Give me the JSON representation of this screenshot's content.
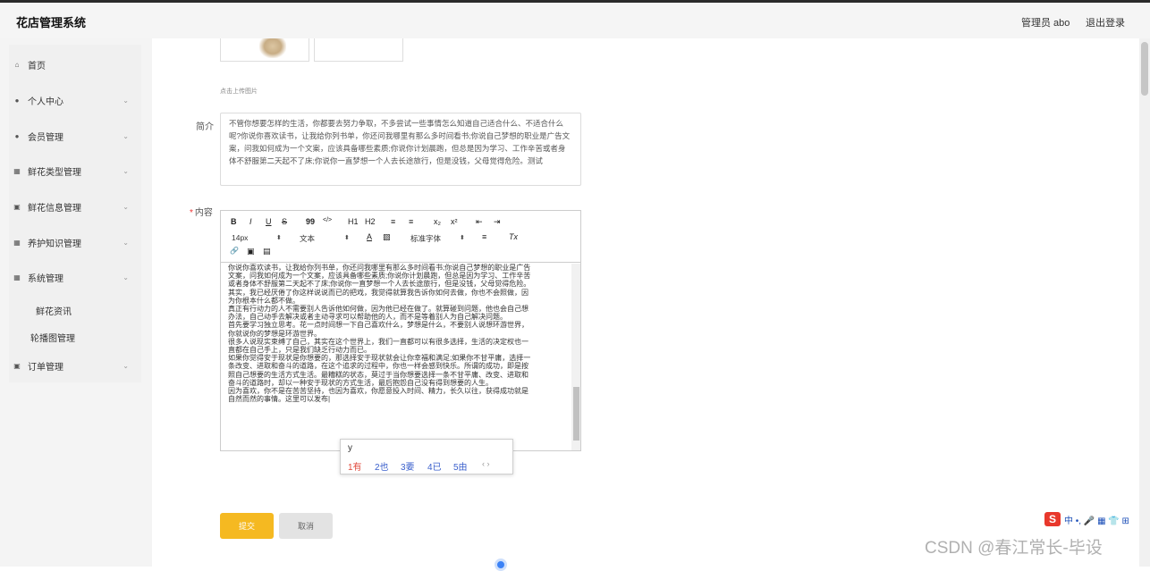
{
  "header": {
    "brand": "花店管理系统",
    "user": "管理员 abo",
    "logout": "退出登录"
  },
  "sidebar": {
    "items": [
      {
        "label": "首页",
        "icon": "home-icon",
        "glyph": "⌂",
        "chevron": false
      },
      {
        "label": "个人中心",
        "icon": "user-icon",
        "glyph": "●",
        "chevron": true
      },
      {
        "label": "会员管理",
        "icon": "member-icon",
        "glyph": "●",
        "chevron": true
      },
      {
        "label": "鲜花类型管理",
        "icon": "grid-icon",
        "glyph": "▦",
        "chevron": true
      },
      {
        "label": "鲜花信息管理",
        "icon": "doc-icon",
        "glyph": "▣",
        "chevron": true
      },
      {
        "label": "养护知识管理",
        "icon": "grid-icon",
        "glyph": "▦",
        "chevron": true
      },
      {
        "label": "系统管理",
        "icon": "grid-icon",
        "glyph": "▦",
        "chevron": true
      },
      {
        "label": "订单管理",
        "icon": "doc-icon",
        "glyph": "▣",
        "chevron": true
      }
    ],
    "subitems": [
      "鲜花资讯",
      "轮播图管理"
    ],
    "chevron_glyph": "⌄"
  },
  "form": {
    "upload_hint": "点击上传图片",
    "intro_label": "简介",
    "intro_text": "不管你想要怎样的生活，你都要去努力争取，不多尝试一些事情怎么知道自己适合什么、不适合什么呢?你说你喜欢读书，让我给你列书单，你还问我哪里有那么多时间看书;你说自己梦想的职业是广告文案，问我如何成为一个文案，应该具备哪些素质;你说你计划晨跑，但总是因为学习、工作辛苦或者身体不舒服第二天起不了床;你说你一直梦想一个人去长途旅行，但是没钱，父母觉得危险。测试",
    "content_label": "内容",
    "required_mark": "*",
    "submit": "提交",
    "cancel": "取消"
  },
  "editor": {
    "toolbar_row1": [
      "B",
      "I",
      "U",
      "S",
      "99",
      "</>",
      "H1",
      "H2",
      "≡",
      "≡",
      "x₂",
      "x²",
      "⇤",
      "⇥"
    ],
    "font_size": "14px",
    "text_style": "文本",
    "font_family": "标准字体",
    "caret": "⬍",
    "color_glyph": "A",
    "bg_glyph": "▨",
    "align_glyph": "≡",
    "clear_glyph": "Tx",
    "link_glyph": "🔗",
    "image_glyph": "▣",
    "video_glyph": "▤",
    "content_lines": [
      "你说你喜欢读书，让我给你列书单，你还问我哪里有那么多时间看书;你说自己梦想的职业是广告",
      "文案，问我如何成为一个文案，应该具备哪些素质;你说你计划晨跑，但总是因为学习、工作辛苦",
      "或者身体不舒服第二天起不了床;你说你一直梦想一个人去长途旅行，但是没钱，父母觉得危险。",
      "其实，我已经厌倦了你这样说说而已的把戏，我觉得就算我告诉你如何去做，你也不会照做，因",
      "为你根本什么都不做。",
      "真正有行动力的人不需要别人告诉他如何做，因为他已经在做了。就算碰到问题，他也会自己想",
      "办法，自己动手去解决或者主动寻求可以帮助他的人，而不是等着别人为自己解决问题。",
      "首先要学习独立思考。花一点时间想一下自己喜欢什么，梦想是什么，不要别人说想环游世界，",
      "你就说你的梦想是环游世界。",
      "很多人说现实束缚了自己，其实在这个世界上，我们一直都可以有很多选择，生活的决定权也一",
      "直都在自己手上，只是我们缺乏行动力而已。",
      "如果你觉得安于现状是你想要的，那选择安于现状就会让你幸福和满足;如果你不甘平庸，选择一",
      "条改变、进取和奋斗的道路，在这个追求的过程中，你也一样会感到快乐。所谓的成功，即是按",
      "照自己想要的生活方式生活。最糟糕的状态，莫过于当你想要选择一条不甘平庸、改变、进取和",
      "奋斗的道路时，却以一种安于现状的方式生活，最后抱怨自己没有得到想要的人生。",
      "因为喜欢，你不是在苦苦坚持，也因为喜欢，你愿意投入时间、精力，长久以往，获得成功就是",
      "自然而然的事情。这里可以发布|"
    ]
  },
  "ime": {
    "input": "y",
    "candidates": [
      "1有",
      "2也",
      "3要",
      "4已",
      "5由"
    ],
    "nav": "‹ ›",
    "tray_logo": "S",
    "tray_text": "中 •, 🎤 ▦ 👕 ⊞"
  },
  "watermark": "CSDN @春江常长-毕设"
}
